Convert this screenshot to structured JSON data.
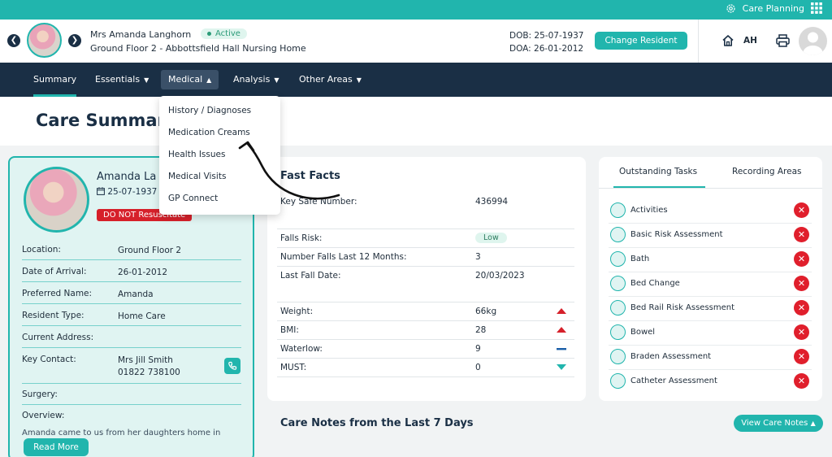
{
  "topbar": {
    "label": "Care Planning",
    "settings_icon": "gear-icon",
    "grid_icon": "apps-grid-icon"
  },
  "resident": {
    "name": "Mrs Amanda Langhorn",
    "status": "Active",
    "location": "Ground Floor 2 - Abbottsfield Hall Nursing Home",
    "dob": "DOB: 25-07-1937",
    "doa": "DOA: 26-01-2012",
    "change_label": "Change Resident"
  },
  "user": {
    "initials": "AH"
  },
  "nav": {
    "items": [
      {
        "label": "Summary"
      },
      {
        "label": "Essentials"
      },
      {
        "label": "Medical"
      },
      {
        "label": "Analysis"
      },
      {
        "label": "Other Areas"
      }
    ]
  },
  "page": {
    "title": "Care Summar"
  },
  "profile": {
    "name": "Amanda La",
    "dob": "25-07-1937",
    "dnr": "DO NOT Resuscitate",
    "rows": [
      {
        "label": "Location:",
        "value": "Ground Floor 2"
      },
      {
        "label": "Date of Arrival:",
        "value": "26-01-2012"
      },
      {
        "label": "Preferred Name:",
        "value": "Amanda"
      },
      {
        "label": "Resident Type:",
        "value": "Home Care"
      },
      {
        "label": "Current Address:",
        "value": ""
      },
      {
        "label": "Key Contact:",
        "value": "Mrs Jill Smith",
        "value2": "01822 738100"
      },
      {
        "label": "Surgery:",
        "value": ""
      },
      {
        "label": "Overview:",
        "value": ""
      }
    ],
    "overview_text": "Amanda came to us from her daughters home in",
    "read_more": "Read More"
  },
  "fast_facts": {
    "title": "Fast Facts",
    "key_safe_label": "Key Safe Number:",
    "key_safe_value": "436994",
    "falls_risk_label": "Falls Risk:",
    "falls_risk_value": "Low",
    "falls_count_label": "Number Falls Last 12 Months:",
    "falls_count_value": "3",
    "last_fall_label": "Last Fall Date:",
    "last_fall_value": "20/03/2023",
    "weight_label": "Weight:",
    "weight_value": "66kg",
    "weight_trend": "up",
    "bmi_label": "BMI:",
    "bmi_value": "28",
    "bmi_trend": "up",
    "waterlow_label": "Waterlow:",
    "waterlow_value": "9",
    "waterlow_trend": "flat",
    "must_label": "MUST:",
    "must_value": "0",
    "must_trend": "down"
  },
  "tasks": {
    "tab_outstanding": "Outstanding Tasks",
    "tab_recording": "Recording Areas",
    "items": [
      {
        "label": "Activities"
      },
      {
        "label": "Basic Risk Assessment"
      },
      {
        "label": "Bath"
      },
      {
        "label": "Bed Change"
      },
      {
        "label": "Bed Rail Risk Assessment"
      },
      {
        "label": "Bowel"
      },
      {
        "label": "Braden Assessment"
      },
      {
        "label": "Catheter Assessment"
      }
    ]
  },
  "care_notes": {
    "title": "Care Notes from the Last 7 Days",
    "button": "View Care Notes"
  },
  "medical_menu": {
    "items": [
      {
        "label": "History / Diagnoses"
      },
      {
        "label": "Medication Creams"
      },
      {
        "label": "Health Issues"
      },
      {
        "label": "Medical Visits"
      },
      {
        "label": "GP Connect"
      }
    ]
  },
  "colors": {
    "accent": "#21b5ad",
    "navy": "#1a2f45",
    "danger": "#e01f2c",
    "trend_up": "#d6202a",
    "trend_flat": "#1a5ea8",
    "trend_down": "#21b5ad"
  }
}
